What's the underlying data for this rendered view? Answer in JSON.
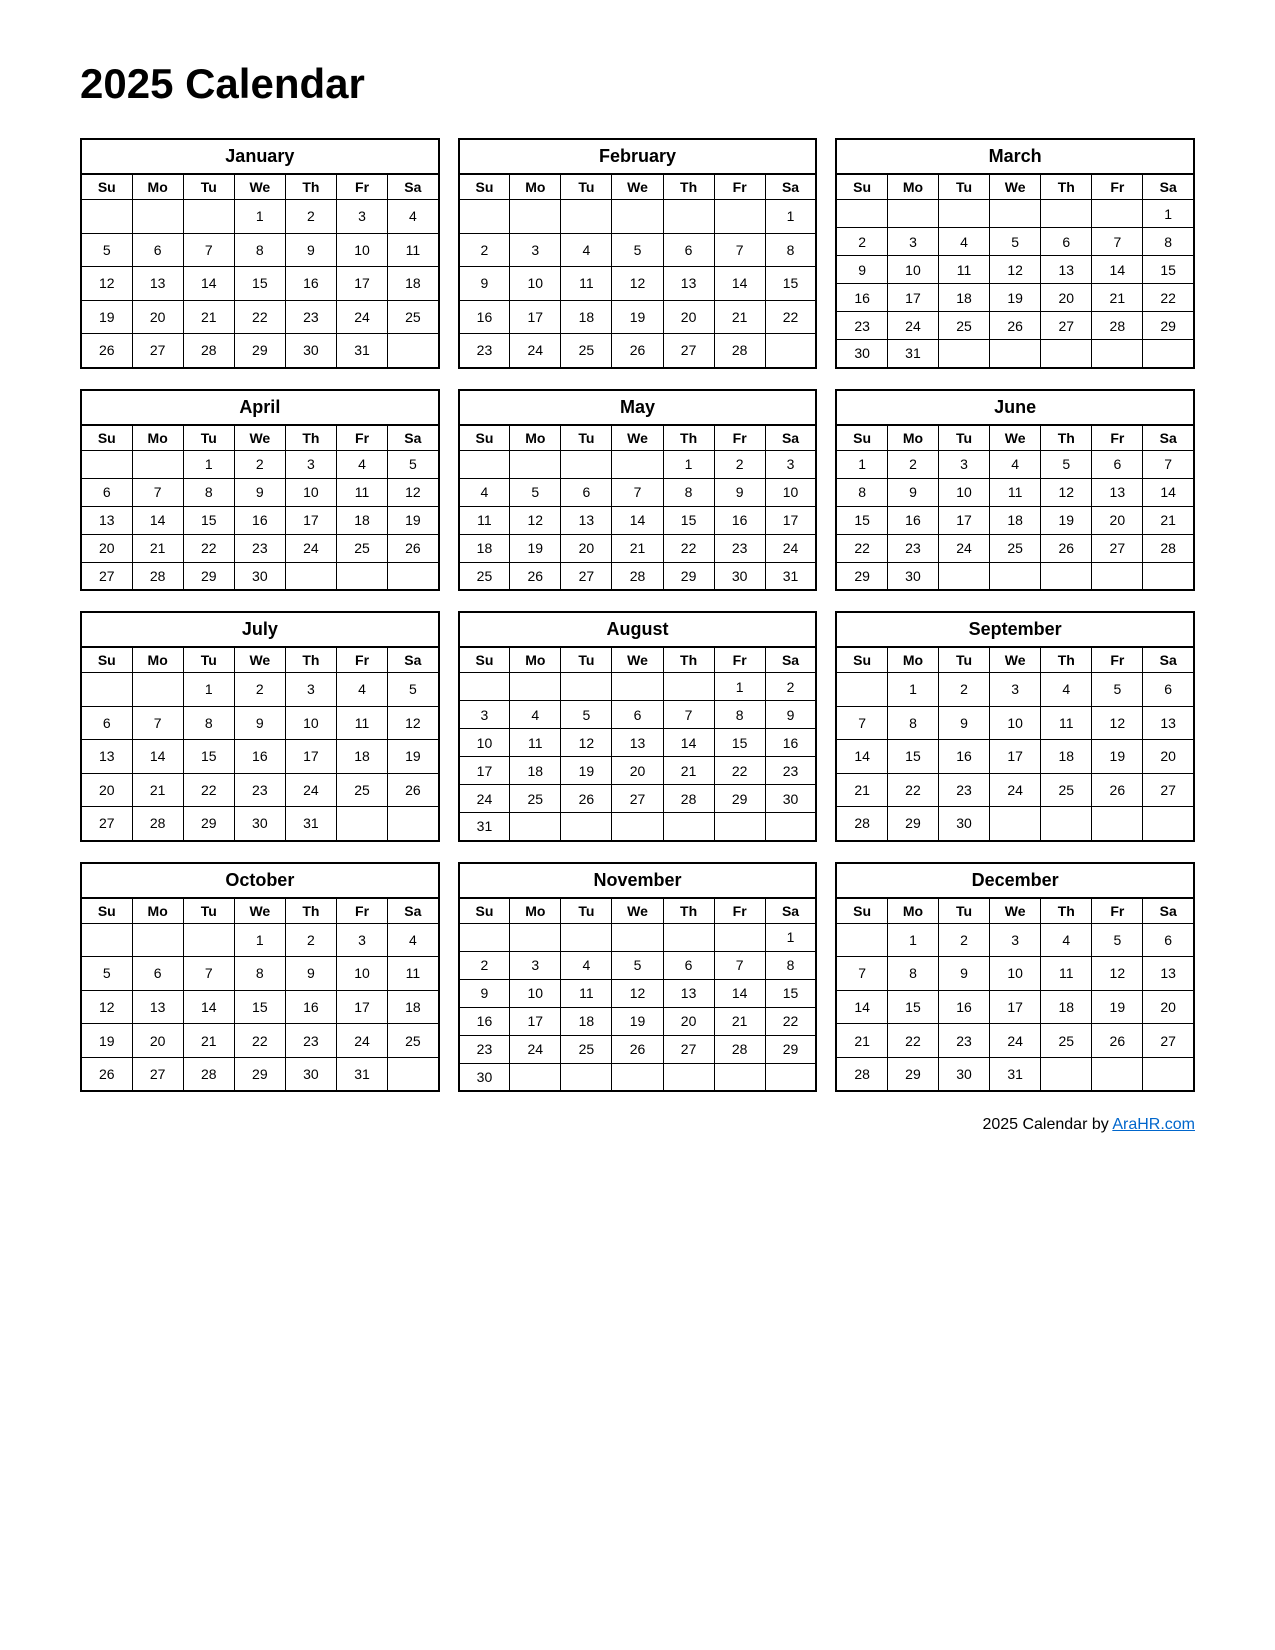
{
  "title": "2025 Calendar",
  "footer": {
    "text": "2025  Calendar by ",
    "link_text": "AraHR.com",
    "link_url": "#"
  },
  "months": [
    {
      "name": "January",
      "weeks": [
        [
          "",
          "",
          "",
          "1",
          "2",
          "3",
          "4"
        ],
        [
          "5",
          "6",
          "7",
          "8",
          "9",
          "10",
          "11"
        ],
        [
          "12",
          "13",
          "14",
          "15",
          "16",
          "17",
          "18"
        ],
        [
          "19",
          "20",
          "21",
          "22",
          "23",
          "24",
          "25"
        ],
        [
          "26",
          "27",
          "28",
          "29",
          "30",
          "31",
          ""
        ]
      ]
    },
    {
      "name": "February",
      "weeks": [
        [
          "",
          "",
          "",
          "",
          "",
          "",
          "1"
        ],
        [
          "2",
          "3",
          "4",
          "5",
          "6",
          "7",
          "8"
        ],
        [
          "9",
          "10",
          "11",
          "12",
          "13",
          "14",
          "15"
        ],
        [
          "16",
          "17",
          "18",
          "19",
          "20",
          "21",
          "22"
        ],
        [
          "23",
          "24",
          "25",
          "26",
          "27",
          "28",
          ""
        ]
      ]
    },
    {
      "name": "March",
      "weeks": [
        [
          "",
          "",
          "",
          "",
          "",
          "",
          "1"
        ],
        [
          "2",
          "3",
          "4",
          "5",
          "6",
          "7",
          "8"
        ],
        [
          "9",
          "10",
          "11",
          "12",
          "13",
          "14",
          "15"
        ],
        [
          "16",
          "17",
          "18",
          "19",
          "20",
          "21",
          "22"
        ],
        [
          "23",
          "24",
          "25",
          "26",
          "27",
          "28",
          "29"
        ],
        [
          "30",
          "31",
          "",
          "",
          "",
          "",
          ""
        ]
      ]
    },
    {
      "name": "April",
      "weeks": [
        [
          "",
          "",
          "1",
          "2",
          "3",
          "4",
          "5"
        ],
        [
          "6",
          "7",
          "8",
          "9",
          "10",
          "11",
          "12"
        ],
        [
          "13",
          "14",
          "15",
          "16",
          "17",
          "18",
          "19"
        ],
        [
          "20",
          "21",
          "22",
          "23",
          "24",
          "25",
          "26"
        ],
        [
          "27",
          "28",
          "29",
          "30",
          "",
          "",
          ""
        ]
      ]
    },
    {
      "name": "May",
      "weeks": [
        [
          "",
          "",
          "",
          "",
          "1",
          "2",
          "3"
        ],
        [
          "4",
          "5",
          "6",
          "7",
          "8",
          "9",
          "10"
        ],
        [
          "11",
          "12",
          "13",
          "14",
          "15",
          "16",
          "17"
        ],
        [
          "18",
          "19",
          "20",
          "21",
          "22",
          "23",
          "24"
        ],
        [
          "25",
          "26",
          "27",
          "28",
          "29",
          "30",
          "31"
        ]
      ]
    },
    {
      "name": "June",
      "weeks": [
        [
          "1",
          "2",
          "3",
          "4",
          "5",
          "6",
          "7"
        ],
        [
          "8",
          "9",
          "10",
          "11",
          "12",
          "13",
          "14"
        ],
        [
          "15",
          "16",
          "17",
          "18",
          "19",
          "20",
          "21"
        ],
        [
          "22",
          "23",
          "24",
          "25",
          "26",
          "27",
          "28"
        ],
        [
          "29",
          "30",
          "",
          "",
          "",
          "",
          ""
        ]
      ]
    },
    {
      "name": "July",
      "weeks": [
        [
          "",
          "",
          "1",
          "2",
          "3",
          "4",
          "5"
        ],
        [
          "6",
          "7",
          "8",
          "9",
          "10",
          "11",
          "12"
        ],
        [
          "13",
          "14",
          "15",
          "16",
          "17",
          "18",
          "19"
        ],
        [
          "20",
          "21",
          "22",
          "23",
          "24",
          "25",
          "26"
        ],
        [
          "27",
          "28",
          "29",
          "30",
          "31",
          "",
          ""
        ]
      ]
    },
    {
      "name": "August",
      "weeks": [
        [
          "",
          "",
          "",
          "",
          "",
          "1",
          "2"
        ],
        [
          "3",
          "4",
          "5",
          "6",
          "7",
          "8",
          "9"
        ],
        [
          "10",
          "11",
          "12",
          "13",
          "14",
          "15",
          "16"
        ],
        [
          "17",
          "18",
          "19",
          "20",
          "21",
          "22",
          "23"
        ],
        [
          "24",
          "25",
          "26",
          "27",
          "28",
          "29",
          "30"
        ],
        [
          "31",
          "",
          "",
          "",
          "",
          "",
          ""
        ]
      ]
    },
    {
      "name": "September",
      "weeks": [
        [
          "",
          "1",
          "2",
          "3",
          "4",
          "5",
          "6"
        ],
        [
          "7",
          "8",
          "9",
          "10",
          "11",
          "12",
          "13"
        ],
        [
          "14",
          "15",
          "16",
          "17",
          "18",
          "19",
          "20"
        ],
        [
          "21",
          "22",
          "23",
          "24",
          "25",
          "26",
          "27"
        ],
        [
          "28",
          "29",
          "30",
          "",
          "",
          "",
          ""
        ]
      ]
    },
    {
      "name": "October",
      "weeks": [
        [
          "",
          "",
          "",
          "1",
          "2",
          "3",
          "4"
        ],
        [
          "5",
          "6",
          "7",
          "8",
          "9",
          "10",
          "11"
        ],
        [
          "12",
          "13",
          "14",
          "15",
          "16",
          "17",
          "18"
        ],
        [
          "19",
          "20",
          "21",
          "22",
          "23",
          "24",
          "25"
        ],
        [
          "26",
          "27",
          "28",
          "29",
          "30",
          "31",
          ""
        ]
      ]
    },
    {
      "name": "November",
      "weeks": [
        [
          "",
          "",
          "",
          "",
          "",
          "",
          "1"
        ],
        [
          "2",
          "3",
          "4",
          "5",
          "6",
          "7",
          "8"
        ],
        [
          "9",
          "10",
          "11",
          "12",
          "13",
          "14",
          "15"
        ],
        [
          "16",
          "17",
          "18",
          "19",
          "20",
          "21",
          "22"
        ],
        [
          "23",
          "24",
          "25",
          "26",
          "27",
          "28",
          "29"
        ],
        [
          "30",
          "",
          "",
          "",
          "",
          "",
          ""
        ]
      ]
    },
    {
      "name": "December",
      "weeks": [
        [
          "",
          "1",
          "2",
          "3",
          "4",
          "5",
          "6"
        ],
        [
          "7",
          "8",
          "9",
          "10",
          "11",
          "12",
          "13"
        ],
        [
          "14",
          "15",
          "16",
          "17",
          "18",
          "19",
          "20"
        ],
        [
          "21",
          "22",
          "23",
          "24",
          "25",
          "26",
          "27"
        ],
        [
          "28",
          "29",
          "30",
          "31",
          "",
          "",
          ""
        ]
      ]
    }
  ],
  "day_headers": [
    "Su",
    "Mo",
    "Tu",
    "We",
    "Th",
    "Fr",
    "Sa"
  ]
}
